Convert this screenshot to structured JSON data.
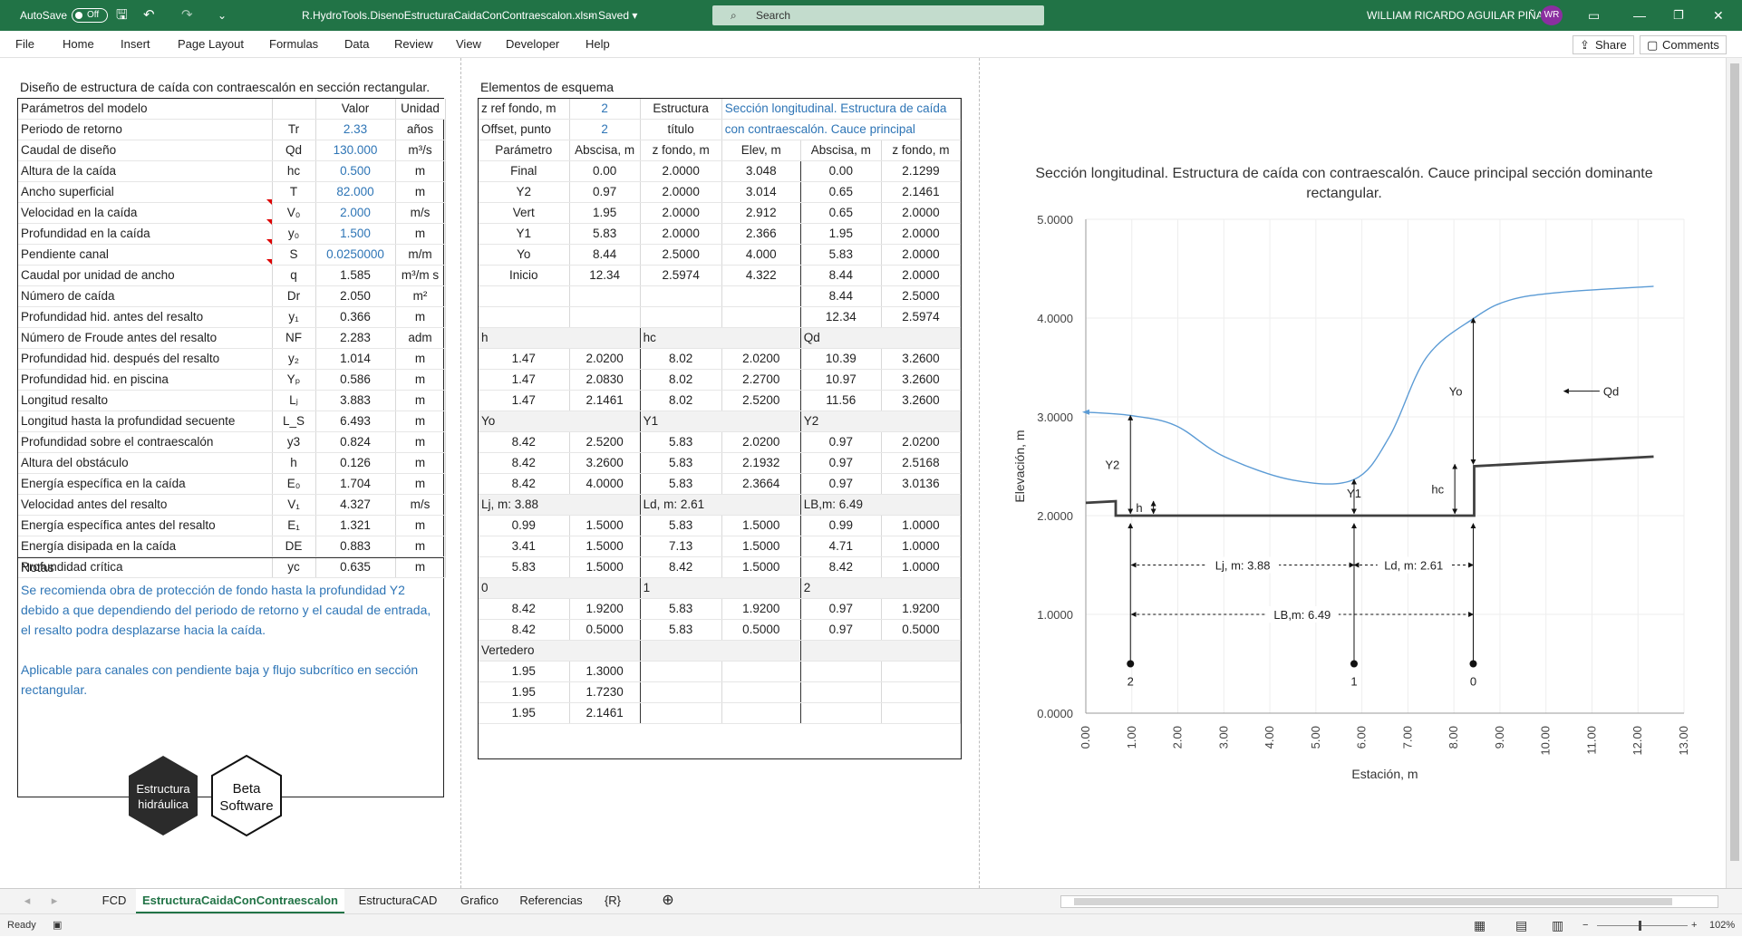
{
  "titlebar": {
    "autosave_label": "AutoSave",
    "autosave_state": "Off",
    "filename": "R.HydroTools.DisenoEstructuraCaidaConContraescalon.xlsm",
    "saved": "Saved",
    "search_placeholder": "Search",
    "user": "WILLIAM RICARDO AGUILAR PIÑA",
    "avatar": "WR"
  },
  "menu": [
    "File",
    "Home",
    "Insert",
    "Page Layout",
    "Formulas",
    "Data",
    "Review",
    "View",
    "Developer",
    "Help"
  ],
  "share": "Share",
  "comments": "Comments",
  "params": {
    "title": "Diseño de estructura de caída con contraescalón en sección rectangular.",
    "headers": [
      "Parámetros del modelo",
      "",
      "Valor",
      "Unidad"
    ],
    "rows": [
      [
        "Periodo de retorno",
        "Tr",
        "2.33",
        "años"
      ],
      [
        "Caudal de diseño",
        "Qd",
        "130.000",
        "m³/s"
      ],
      [
        "Altura de la caída",
        "hc",
        "0.500",
        "m"
      ],
      [
        "Ancho superficial",
        "T",
        "82.000",
        "m"
      ],
      [
        "Velocidad en la caída",
        "V₀",
        "2.000",
        "m/s"
      ],
      [
        "Profundidad en la caída",
        "y₀",
        "1.500",
        "m"
      ],
      [
        "Pendiente canal",
        "S",
        "0.0250000",
        "m/m"
      ],
      [
        "Caudal por unidad de ancho",
        "q",
        "1.585",
        "m³/m s"
      ],
      [
        "Número de caída",
        "Dr",
        "2.050",
        "m²"
      ],
      [
        "Profundidad hid. antes del resalto",
        "y₁",
        "0.366",
        "m"
      ],
      [
        "Número de Froude antes del resalto",
        "NF",
        "2.283",
        "adm"
      ],
      [
        "Profundidad hid. después del resalto",
        "y₂",
        "1.014",
        "m"
      ],
      [
        "Profundidad hid. en piscina",
        "Yₚ",
        "0.586",
        "m"
      ],
      [
        "Longitud resalto",
        "Lⱼ",
        "3.883",
        "m"
      ],
      [
        "Longitud hasta la profundidad secuente",
        "L_S",
        "6.493",
        "m"
      ],
      [
        "Profundidad sobre el contraescalón",
        "y3",
        "0.824",
        "m"
      ],
      [
        "Altura del obstáculo",
        "h",
        "0.126",
        "m"
      ],
      [
        "Energía específica en la caída",
        "E₀",
        "1.704",
        "m"
      ],
      [
        "Velocidad antes del resalto",
        "V₁",
        "4.327",
        "m/s"
      ],
      [
        "Energía específica antes del resalto",
        "E₁",
        "1.321",
        "m"
      ],
      [
        "Energía disipada en la caída",
        "DE",
        "0.883",
        "m"
      ],
      [
        "Profundidad crítica",
        "yc",
        "0.635",
        "m"
      ]
    ],
    "notes_title": "Notas",
    "note1": "Se recomienda obra de protección de fondo hasta la profundidad Y2 debido a que dependiendo del periodo de retorno y el caudal de entrada, el resalto podra desplazarse hacia la caída.",
    "note2": "Aplicable para canales con pendiente baja y flujo subcrítico en sección rectangular."
  },
  "logos": {
    "hex1": [
      "Estructura",
      "hidráulica"
    ],
    "hex2": [
      "Beta",
      "Software"
    ]
  },
  "schema": {
    "title": "Elementos de esquema",
    "zref_label": "z ref fondo, m",
    "zref_value": "2",
    "offset_label": "Offset, punto",
    "offset_value": "2",
    "struct_label1": "Estructura",
    "struct_label2": "título",
    "struct_title1": "Sección longitudinal. Estructura de caída",
    "struct_title2": "con contraescalón. Cauce principal",
    "headers": [
      "Parámetro",
      "Abscisa, m",
      "z fondo, m",
      "Elev, m",
      "Abscisa, m",
      "z fondo, m"
    ],
    "rows": [
      [
        "Final",
        "0.00",
        "2.0000",
        "3.048",
        "0.00",
        "2.1299"
      ],
      [
        "Y2",
        "0.97",
        "2.0000",
        "3.014",
        "0.65",
        "2.1461"
      ],
      [
        "Vert",
        "1.95",
        "2.0000",
        "2.912",
        "0.65",
        "2.0000"
      ],
      [
        "Y1",
        "5.83",
        "2.0000",
        "2.366",
        "1.95",
        "2.0000"
      ],
      [
        "Yo",
        "8.44",
        "2.5000",
        "4.000",
        "5.83",
        "2.0000"
      ],
      [
        "Inicio",
        "12.34",
        "2.5974",
        "4.322",
        "8.44",
        "2.0000"
      ],
      [
        "",
        "",
        "",
        "",
        "8.44",
        "2.5000"
      ],
      [
        "",
        "",
        "",
        "",
        "12.34",
        "2.5974"
      ]
    ],
    "blocks": [
      {
        "labels": [
          "h",
          "hc",
          "Qd"
        ],
        "rows": [
          [
            "1.47",
            "2.0200",
            "8.02",
            "2.0200",
            "10.39",
            "3.2600"
          ],
          [
            "1.47",
            "2.0830",
            "8.02",
            "2.2700",
            "10.97",
            "3.2600"
          ],
          [
            "1.47",
            "2.1461",
            "8.02",
            "2.5200",
            "11.56",
            "3.2600"
          ]
        ]
      },
      {
        "labels": [
          "Yo",
          "Y1",
          "Y2"
        ],
        "rows": [
          [
            "8.42",
            "2.5200",
            "5.83",
            "2.0200",
            "0.97",
            "2.0200"
          ],
          [
            "8.42",
            "3.2600",
            "5.83",
            "2.1932",
            "0.97",
            "2.5168"
          ],
          [
            "8.42",
            "4.0000",
            "5.83",
            "2.3664",
            "0.97",
            "3.0136"
          ]
        ]
      },
      {
        "labels": [
          "Lj, m: 3.88",
          "Ld, m: 2.61",
          "LB,m: 6.49"
        ],
        "rows": [
          [
            "0.99",
            "1.5000",
            "5.83",
            "1.5000",
            "0.99",
            "1.0000"
          ],
          [
            "3.41",
            "1.5000",
            "7.13",
            "1.5000",
            "4.71",
            "1.0000"
          ],
          [
            "5.83",
            "1.5000",
            "8.42",
            "1.5000",
            "8.42",
            "1.0000"
          ]
        ]
      },
      {
        "labels": [
          "0",
          "1",
          "2"
        ],
        "rows": [
          [
            "8.42",
            "1.9200",
            "5.83",
            "1.9200",
            "0.97",
            "1.9200"
          ],
          [
            "8.42",
            "0.5000",
            "5.83",
            "0.5000",
            "0.97",
            "0.5000"
          ]
        ]
      },
      {
        "labels": [
          "Vertedero",
          "",
          ""
        ],
        "rows": [
          [
            "1.95",
            "1.3000",
            "",
            "",
            "",
            ""
          ],
          [
            "1.95",
            "1.7230",
            "",
            "",
            "",
            ""
          ],
          [
            "1.95",
            "2.1461",
            "",
            "",
            "",
            ""
          ]
        ]
      }
    ]
  },
  "chart_data": {
    "type": "line",
    "title": "Sección longitudinal. Estructura de caída con contraescalón. Cauce principal sección dominante rectangular.",
    "xlabel": "Estación, m",
    "ylabel": "Elevación, m",
    "xlim": [
      0,
      13
    ],
    "ylim": [
      0,
      5
    ],
    "xticks": [
      "0.00",
      "1.00",
      "2.00",
      "3.00",
      "4.00",
      "5.00",
      "6.00",
      "7.00",
      "8.00",
      "9.00",
      "10.00",
      "11.00",
      "12.00",
      "13.00"
    ],
    "yticks": [
      "0.0000",
      "1.0000",
      "2.0000",
      "3.0000",
      "4.0000",
      "5.0000"
    ],
    "series": [
      {
        "role": "water",
        "color": "#5b9bd5",
        "x": [
          0,
          0.97,
          1.95,
          3.0,
          4.5,
          5.83,
          6.6,
          7.4,
          8.44,
          9.2,
          10.3,
          12.34
        ],
        "y": [
          3.048,
          3.014,
          2.912,
          2.6,
          2.36,
          2.366,
          2.8,
          3.6,
          4.0,
          4.18,
          4.26,
          4.322
        ]
      },
      {
        "role": "bed",
        "color": "#404040",
        "x": [
          0,
          0.65,
          0.65,
          1.95,
          5.83,
          8.44,
          8.44,
          12.34
        ],
        "y": [
          2.1299,
          2.1461,
          2.0,
          2.0,
          2.0,
          2.0,
          2.5,
          2.5974
        ]
      }
    ],
    "verticals": [
      {
        "label": "Y2",
        "x": 0.97,
        "y1": 2.02,
        "y2": 3.0136
      },
      {
        "label": "h",
        "x": 1.47,
        "y1": 2.02,
        "y2": 2.1461
      },
      {
        "label": "Y1",
        "x": 5.83,
        "y1": 2.02,
        "y2": 2.3664
      },
      {
        "label": "hc",
        "x": 8.02,
        "y1": 2.02,
        "y2": 2.52
      },
      {
        "label": "Yo",
        "x": 8.42,
        "y1": 2.52,
        "y2": 4.0
      }
    ],
    "dimensions": [
      {
        "label": "Lj, m: 3.88",
        "x1": 0.99,
        "x2": 5.83,
        "y": 1.5
      },
      {
        "label": "Ld, m: 2.61",
        "x1": 5.83,
        "x2": 8.42,
        "y": 1.5
      },
      {
        "label": "LB,m: 6.49",
        "x1": 0.99,
        "x2": 8.42,
        "y": 1.0
      }
    ],
    "points": [
      {
        "label": "2",
        "x": 0.97,
        "y1": 0.5,
        "y2": 1.92
      },
      {
        "label": "1",
        "x": 5.83,
        "y1": 0.5,
        "y2": 1.92
      },
      {
        "label": "0",
        "x": 8.42,
        "y1": 0.5,
        "y2": 1.92
      }
    ],
    "flow_label": {
      "label": "Qd",
      "x1": 10.39,
      "x2": 11.56,
      "y": 3.26
    }
  },
  "tabs": [
    "FCD",
    "EstructuraCaidaConContraescalon",
    "EstructuraCAD",
    "Grafico",
    "Referencias",
    "{R}"
  ],
  "status": {
    "ready": "Ready",
    "zoom": "102%"
  }
}
